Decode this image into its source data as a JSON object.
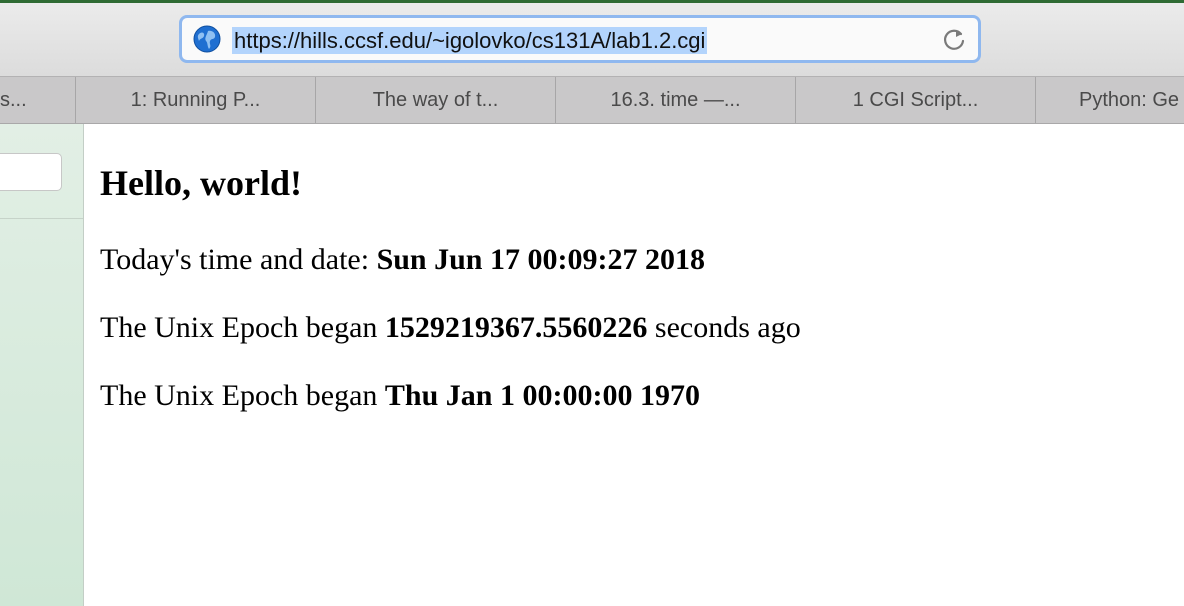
{
  "browser": {
    "url": "https://hills.ccsf.edu/~igolovko/cs131A/lab1.2.cgi",
    "tabs": [
      {
        "label": "s..."
      },
      {
        "label": "1: Running P..."
      },
      {
        "label": "The way of t..."
      },
      {
        "label": "16.3. time —..."
      },
      {
        "label": "1 CGI Script..."
      },
      {
        "label": "Python: Ge"
      }
    ],
    "sidebar_field_text": ")"
  },
  "page": {
    "heading": "Hello, world!",
    "line1_label": "Today's time and date: ",
    "line1_value": "Sun Jun 17 00:09:27 2018",
    "line2_label": "The Unix Epoch began ",
    "line2_value": "1529219367.5560226",
    "line2_suffix": " seconds ago",
    "line3_label": "The Unix Epoch began ",
    "line3_value": "Thu Jan 1 00:00:00 1970"
  },
  "colors": {
    "url_selection": "#b3d4fc",
    "url_focus_ring": "#8fb8ef",
    "sidebar": "#d6eadb"
  }
}
